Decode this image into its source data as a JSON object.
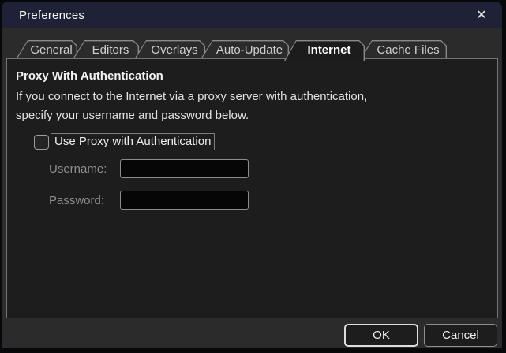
{
  "titlebar": {
    "title": "Preferences",
    "close_icon": "✕"
  },
  "tabs": [
    {
      "label": "General",
      "selected": false
    },
    {
      "label": "Editors",
      "selected": false
    },
    {
      "label": "Overlays",
      "selected": false
    },
    {
      "label": "Auto-Update",
      "selected": false
    },
    {
      "label": "Internet",
      "selected": true
    },
    {
      "label": "Cache Files",
      "selected": false
    }
  ],
  "panel": {
    "heading": "Proxy With Authentication",
    "description_line1": "If you connect to the Internet via a proxy server with authentication,",
    "description_line2": "specify your username and password below.",
    "checkbox": {
      "label": "Use Proxy with Authentication",
      "checked": false
    },
    "fields": [
      {
        "label": "Username:",
        "value": "",
        "type": "text"
      },
      {
        "label": "Password:",
        "value": "",
        "type": "password"
      }
    ]
  },
  "buttons": {
    "ok": "OK",
    "cancel": "Cancel"
  },
  "colors": {
    "titlebar": "#1f2237",
    "dialog_bg": "#2b2b2b",
    "panel_bg": "#1d1d1d",
    "border": "#8c8c8c",
    "selected_tab_text": "#ffffff"
  }
}
